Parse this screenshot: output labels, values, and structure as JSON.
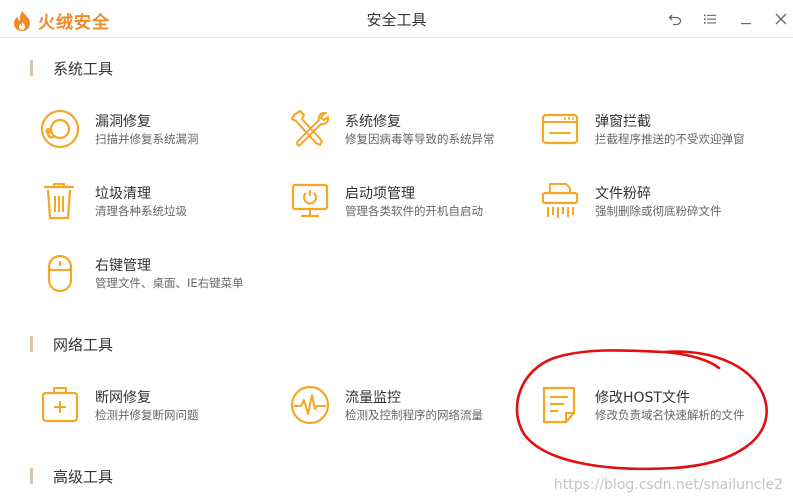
{
  "app": {
    "name": "火绒安全",
    "window_title": "安全工具"
  },
  "sections": {
    "system": {
      "title": "系统工具"
    },
    "network": {
      "title": "网络工具"
    },
    "advanced": {
      "title": "高级工具"
    }
  },
  "tools": {
    "leak_repair": {
      "name": "漏洞修复",
      "desc": "扫描并修复系统漏洞",
      "icon": "lifebuoy-icon"
    },
    "system_repair": {
      "name": "系统修复",
      "desc": "修复因病毒等导致的系统异常",
      "icon": "wrench-screwdriver-icon"
    },
    "popup_block": {
      "name": "弹窗拦截",
      "desc": "拦截程序推送的不受欢迎弹窗",
      "icon": "popup-window-icon"
    },
    "junk_clean": {
      "name": "垃圾清理",
      "desc": "清理各种系统垃圾",
      "icon": "trash-icon"
    },
    "startup_mgr": {
      "name": "启动项管理",
      "desc": "管理各类软件的开机自启动",
      "icon": "monitor-icon"
    },
    "file_shred": {
      "name": "文件粉碎",
      "desc": "强制删除或彻底粉碎文件",
      "icon": "shredder-icon"
    },
    "context_menu": {
      "name": "右键管理",
      "desc": "管理文件、桌面、IE右键菜单",
      "icon": "mouse-icon"
    },
    "net_repair": {
      "name": "断网修复",
      "desc": "检测并修复断网问题",
      "icon": "toolbox-icon"
    },
    "traffic_monitor": {
      "name": "流量监控",
      "desc": "检测及控制程序的网络流量",
      "icon": "gauge-icon"
    },
    "host_edit": {
      "name": "修改HOST文件",
      "desc": "修改负责域名快速解析的文件",
      "icon": "document-icon"
    }
  },
  "watermark": "https://blog.csdn.net/snailuncle2",
  "colors": {
    "accent": "#f5a623",
    "logo": "#f08a24",
    "annotation": "#e01010"
  }
}
